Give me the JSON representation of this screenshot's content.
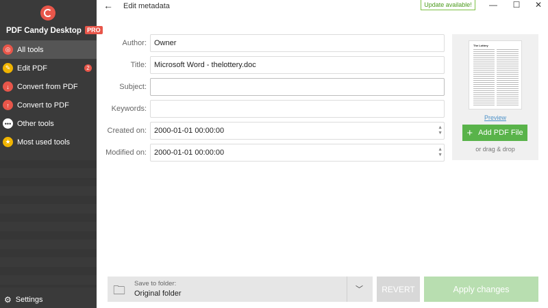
{
  "app": {
    "name": "PDF Candy Desktop",
    "badge": "PRO"
  },
  "sidebar": {
    "items": [
      {
        "label": "All tools",
        "icon": "spiral-icon",
        "active": true
      },
      {
        "label": "Edit PDF",
        "icon": "pencil-icon",
        "badge": "2"
      },
      {
        "label": "Convert from PDF",
        "icon": "arrow-down-icon"
      },
      {
        "label": "Convert to PDF",
        "icon": "arrow-up-icon"
      },
      {
        "label": "Other tools",
        "icon": "dots-icon"
      },
      {
        "label": "Most used tools",
        "icon": "star-icon"
      }
    ],
    "settings_label": "Settings"
  },
  "header": {
    "title": "Edit metadata",
    "update_label": "Update available!"
  },
  "form": {
    "author": {
      "label": "Author:",
      "value": "Owner"
    },
    "title": {
      "label": "Title:",
      "value": "Microsoft Word - thelottery.doc"
    },
    "subject": {
      "label": "Subject:",
      "value": ""
    },
    "keywords": {
      "label": "Keywords:",
      "value": ""
    },
    "created": {
      "label": "Created on:",
      "value": "2000-01-01 00:00:00"
    },
    "modified": {
      "label": "Modified on:",
      "value": "2000-01-01 00:00:00"
    }
  },
  "preview": {
    "doc_title": "The Lottery",
    "link_label": "Preview",
    "add_button_label": "Add PDF File",
    "drag_text": "or drag & drop"
  },
  "footer": {
    "save_to_label": "Save to folder:",
    "save_to_value": "Original folder",
    "revert_label": "REVERT",
    "apply_label": "Apply changes"
  },
  "colors": {
    "accent_red": "#e8564a",
    "accent_green": "#59b34a",
    "sidebar_bg": "#3a3a3a"
  }
}
